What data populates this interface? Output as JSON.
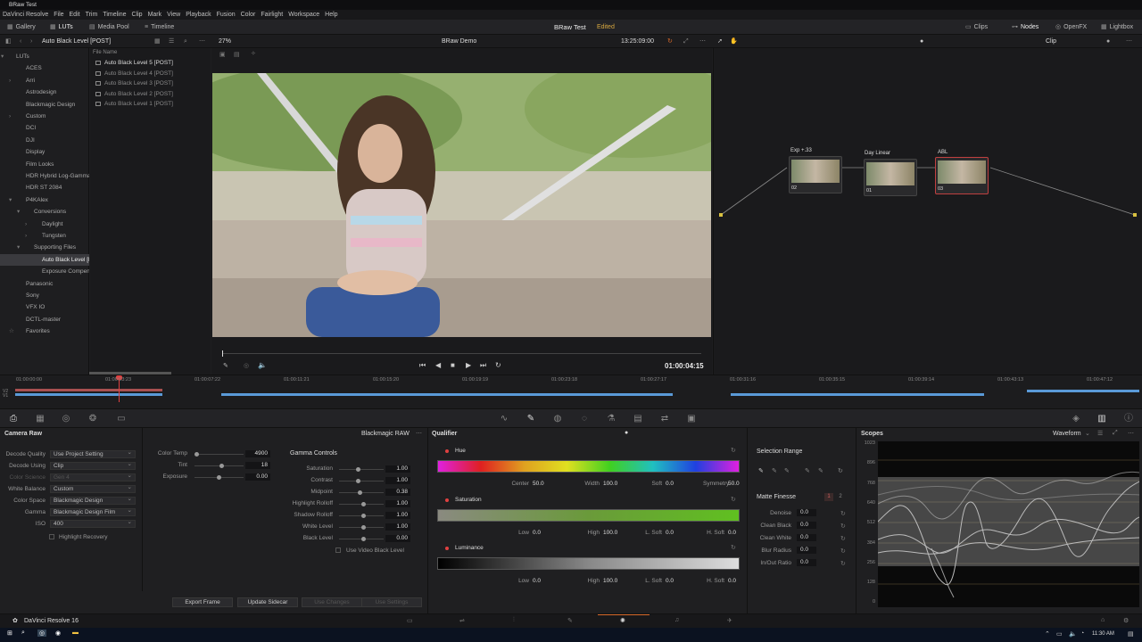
{
  "window": {
    "title": "BRaw Test"
  },
  "menu": [
    "DaVinci Resolve",
    "File",
    "Edit",
    "Trim",
    "Timeline",
    "Clip",
    "Mark",
    "View",
    "Playback",
    "Fusion",
    "Color",
    "Fairlight",
    "Workspace",
    "Help"
  ],
  "toolbar": {
    "left": [
      "Gallery",
      "LUTs",
      "Media Pool",
      "Timeline"
    ],
    "project": "BRaw Test",
    "status": "Edited",
    "right": [
      "Clips",
      "Nodes",
      "OpenFX",
      "Lightbox"
    ]
  },
  "secondary": {
    "lut_folder": "Auto Black Level [POST]",
    "zoom": "27%",
    "timeline": "BRaw Demo",
    "timecode": "13:25:09:00",
    "node_mode": "Clip"
  },
  "lut_tree": [
    {
      "label": "LUTs",
      "indent": 0,
      "chev": "▾"
    },
    {
      "label": "ACES",
      "indent": 1,
      "chev": ""
    },
    {
      "label": "Arri",
      "indent": 1,
      "chev": "›"
    },
    {
      "label": "Astrodesign",
      "indent": 1,
      "chev": ""
    },
    {
      "label": "Blackmagic Design",
      "indent": 1,
      "chev": ""
    },
    {
      "label": "Custom",
      "indent": 1,
      "chev": "›"
    },
    {
      "label": "DCI",
      "indent": 1,
      "chev": ""
    },
    {
      "label": "DJI",
      "indent": 1,
      "chev": ""
    },
    {
      "label": "Display",
      "indent": 1,
      "chev": ""
    },
    {
      "label": "Film Looks",
      "indent": 1,
      "chev": ""
    },
    {
      "label": "HDR Hybrid Log-Gamma",
      "indent": 1,
      "chev": ""
    },
    {
      "label": "HDR ST 2084",
      "indent": 1,
      "chev": ""
    },
    {
      "label": "P4KAlex",
      "indent": 1,
      "chev": "▾"
    },
    {
      "label": "Conversions",
      "indent": 2,
      "chev": "▾"
    },
    {
      "label": "Daylight",
      "indent": 3,
      "chev": "›"
    },
    {
      "label": "Tungsten",
      "indent": 3,
      "chev": "›"
    },
    {
      "label": "Supporting Files",
      "indent": 2,
      "chev": "▾"
    },
    {
      "label": "Auto Black Level [PO...",
      "indent": 3,
      "chev": "",
      "sel": true
    },
    {
      "label": "Exposure Compensa...",
      "indent": 3,
      "chev": ""
    },
    {
      "label": "Panasonic",
      "indent": 1,
      "chev": ""
    },
    {
      "label": "Sony",
      "indent": 1,
      "chev": ""
    },
    {
      "label": "VFX IO",
      "indent": 1,
      "chev": ""
    },
    {
      "label": "DCTL-master",
      "indent": 1,
      "chev": ""
    },
    {
      "label": "Favorites",
      "indent": 1,
      "chev": "☆"
    }
  ],
  "files": {
    "header": "File Name",
    "items": [
      "Auto Black Level 5 [POST]",
      "Auto Black Level 4 [POST]",
      "Auto Black Level 3 [POST]",
      "Auto Black Level 2 [POST]",
      "Auto Black Level 1 [POST]"
    ]
  },
  "player": {
    "timecode": "01:00:04:15"
  },
  "nodes": [
    {
      "title": "Exp +.33",
      "num": "02"
    },
    {
      "title": "Day Linear",
      "num": "01"
    },
    {
      "title": "ABL",
      "num": "03"
    }
  ],
  "timeline": {
    "ticks": [
      "01:00:00:00",
      "01:00:03:23",
      "01:00:07:22",
      "01:00:11:21",
      "01:00:15:20",
      "01:00:19:19",
      "01:00:23:18",
      "01:00:27:17",
      "01:00:31:16",
      "01:00:35:15",
      "01:00:39:14",
      "01:00:43:13",
      "01:00:47:12"
    ],
    "tracks": [
      "V2",
      "V1"
    ]
  },
  "camera_raw": {
    "title": "Camera Raw",
    "format": "Blackmagic RAW",
    "fields": [
      {
        "label": "Decode Quality",
        "value": "Use Project Setting",
        "dim": false
      },
      {
        "label": "Decode Using",
        "value": "Clip",
        "dim": false
      },
      {
        "label": "Color Science",
        "value": "Gen 4",
        "dim": true
      },
      {
        "label": "White Balance",
        "value": "Custom",
        "dim": false
      },
      {
        "label": "Color Space",
        "value": "Blackmagic Design",
        "dim": false
      },
      {
        "label": "Gamma",
        "value": "Blackmagic Design Film",
        "dim": false
      },
      {
        "label": "ISO",
        "value": "400",
        "dim": false
      }
    ],
    "highlight_recovery": "Highlight Recovery",
    "sliders": [
      {
        "label": "Color Temp",
        "value": "4900",
        "pos": 0.0
      },
      {
        "label": "Tint",
        "value": "18",
        "pos": 0.55
      },
      {
        "label": "Exposure",
        "value": "0.00",
        "pos": 0.5
      }
    ],
    "gamma_title": "Gamma Controls",
    "gamma": [
      {
        "label": "Saturation",
        "value": "1.00",
        "pos": 0.5
      },
      {
        "label": "Contrast",
        "value": "1.00",
        "pos": 0.5
      },
      {
        "label": "Midpoint",
        "value": "0.38",
        "pos": 0.6
      },
      {
        "label": "Highlight Rolloff",
        "value": "1.00",
        "pos": 0.85
      },
      {
        "label": "Shadow Rolloff",
        "value": "1.00",
        "pos": 0.85
      },
      {
        "label": "White Level",
        "value": "1.00",
        "pos": 0.85
      },
      {
        "label": "Black Level",
        "value": "0.00",
        "pos": 0.85
      }
    ],
    "use_video_black": "Use Video Black Level",
    "buttons": [
      {
        "label": "Export Frame",
        "dis": false
      },
      {
        "label": "Update Sidecar",
        "dis": false
      },
      {
        "label": "Use Changes",
        "dis": true
      },
      {
        "label": "Use Settings",
        "dis": true
      }
    ]
  },
  "qualifier": {
    "title": "Qualifier",
    "mode": "HSL",
    "hue": {
      "label": "Hue",
      "params": [
        {
          "k": "Center",
          "v": "50.0"
        },
        {
          "k": "Width",
          "v": "100.0"
        },
        {
          "k": "Soft",
          "v": "0.0"
        },
        {
          "k": "Symmetry",
          "v": "50.0"
        }
      ]
    },
    "saturation": {
      "label": "Saturation",
      "params": [
        {
          "k": "Low",
          "v": "0.0"
        },
        {
          "k": "High",
          "v": "100.0"
        },
        {
          "k": "L. Soft",
          "v": "0.0"
        },
        {
          "k": "H. Soft",
          "v": "0.0"
        }
      ]
    },
    "luminance": {
      "label": "Luminance",
      "params": [
        {
          "k": "Low",
          "v": "0.0"
        },
        {
          "k": "High",
          "v": "100.0"
        },
        {
          "k": "L. Soft",
          "v": "0.0"
        },
        {
          "k": "H. Soft",
          "v": "0.0"
        }
      ]
    }
  },
  "selection": {
    "title": "Selection Range",
    "matte_title": "Matte Finesse",
    "matte_tabs": [
      "1",
      "2"
    ],
    "matte": [
      {
        "label": "Denoise",
        "value": "0.0"
      },
      {
        "label": "Clean Black",
        "value": "0.0"
      },
      {
        "label": "Clean White",
        "value": "0.0"
      },
      {
        "label": "Blur Radius",
        "value": "0.0"
      },
      {
        "label": "In/Out Ratio",
        "value": "0.0"
      }
    ]
  },
  "scopes": {
    "title": "Scopes",
    "mode": "Waveform",
    "scale": [
      "1023",
      "896",
      "768",
      "640",
      "512",
      "384",
      "256",
      "128",
      "0"
    ]
  },
  "app": {
    "name": "DaVinci Resolve 16"
  },
  "tray": {
    "time": "11:30 AM"
  }
}
